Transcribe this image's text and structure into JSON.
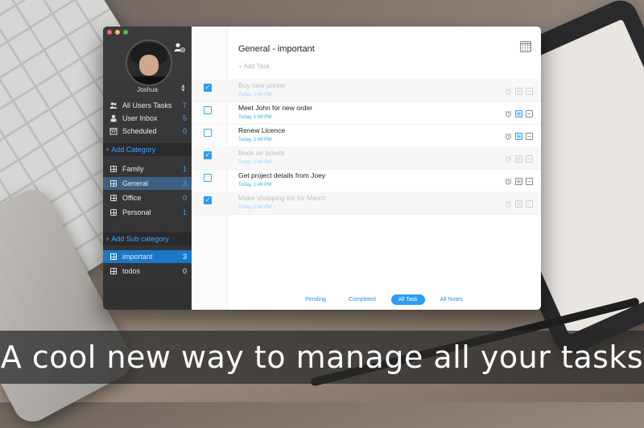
{
  "app": {
    "user": {
      "name": "Joshua"
    },
    "main_nav": [
      {
        "label": "All Users Tasks",
        "count": "7",
        "icon": "users-icon"
      },
      {
        "label": "User Inbox",
        "count": "5",
        "icon": "inbox-icon"
      },
      {
        "label": "Scheduled",
        "count": "0",
        "icon": "calendar-icon"
      }
    ],
    "add_category_label": "+ Add Category",
    "categories": [
      {
        "label": "Family",
        "count": "1"
      },
      {
        "label": "General",
        "count": "3"
      },
      {
        "label": "Office",
        "count": "0"
      },
      {
        "label": "Personal",
        "count": "1"
      }
    ],
    "add_subcategory_label": "+ Add Sub category",
    "subcategories": [
      {
        "label": "important",
        "count": "3"
      },
      {
        "label": "todos",
        "count": "0"
      }
    ]
  },
  "main": {
    "title": "General - important",
    "add_task_placeholder": "+ Add Task",
    "tasks": [
      {
        "name": "Buy new printer",
        "date": "Today, 1:49 PM",
        "done": true
      },
      {
        "name": "Meet John for new order",
        "date": "Today, 1:49 PM",
        "done": false
      },
      {
        "name": "Renew Licence",
        "date": "Today, 1:49 PM",
        "done": false
      },
      {
        "name": "Book air tickets",
        "date": "Today, 1:49 PM",
        "done": true
      },
      {
        "name": "Get project details from Joey",
        "date": "Today, 1:49 PM",
        "done": false
      },
      {
        "name": "Make shopping list for March",
        "date": "Today, 1:48 PM",
        "done": true
      }
    ],
    "tabs": [
      "Pending",
      "Completed",
      "All Task",
      "All Notes"
    ],
    "active_tab": "All Task"
  },
  "banner": {
    "text": "A cool new way to manage all your tasks"
  },
  "colors": {
    "accent": "#2d9cf2",
    "sidebar": "#3b3b3d",
    "selected": "#1a78c9"
  }
}
